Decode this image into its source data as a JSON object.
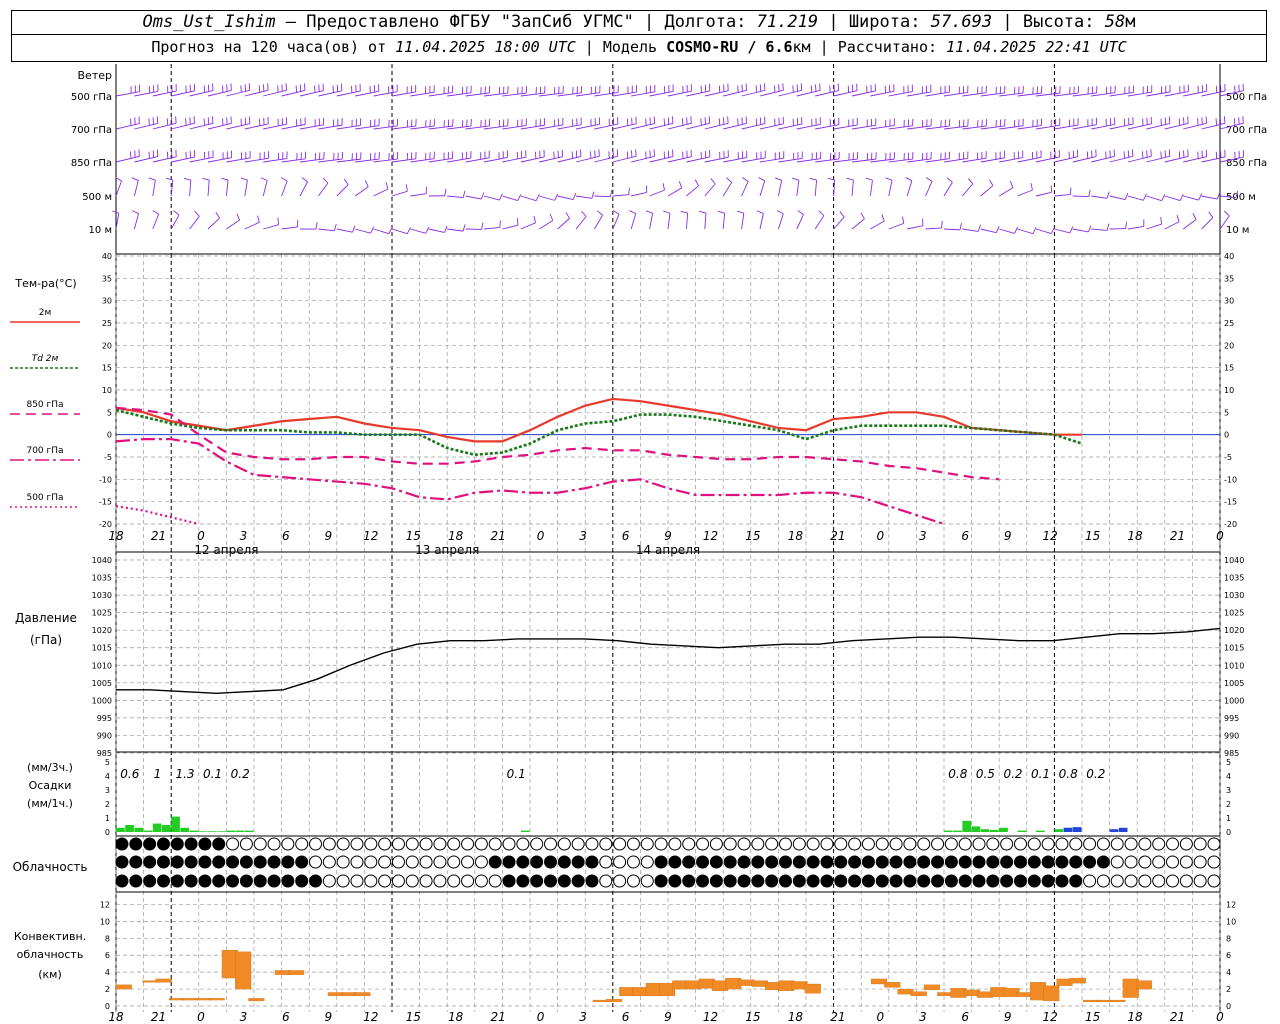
{
  "header": {
    "station": "Oms_Ust_Ishim",
    "dash": "–",
    "provider": "Предоставлено ФГБУ \"ЗапСиб УГМС\"",
    "lon_label": "Долгота:",
    "lon": "71.219",
    "lat_label": "Широта:",
    "lat": "57.693",
    "alt_label": "Высота:",
    "alt": "58",
    "alt_unit": "м",
    "forecast_label": "Прогноз на 120 часа(ов) от",
    "forecast_from": "11.04.2025 18:00 UTC",
    "model_label": "Модель",
    "model": "COSMO-RU / 6.6",
    "model_unit": "км",
    "calc_label": "Рассчитано:",
    "calc_time": "11.04.2025 22:41 UTC"
  },
  "colors": {
    "wind": "#8a2be2",
    "t2m": "#e8392b",
    "td2m": "#1a7a1a",
    "t850": "#e0107f",
    "precip_rain": "#22cc22",
    "precip_snow": "#2244dd",
    "convective": "#f08a24",
    "grid": "#9a9a9a",
    "zero_line": "#1f3fd0"
  },
  "chart_data": [
    {
      "type": "wind_barbs",
      "title": "Ветер",
      "levels": [
        "500 гПа",
        "700 гПа",
        "850 гПа",
        "500 м",
        "10 м"
      ]
    },
    {
      "type": "line",
      "title": "Тем-ра(°С)",
      "ylim": [
        -20,
        40
      ],
      "yticks": [
        -20,
        -15,
        -10,
        -5,
        0,
        5,
        10,
        15,
        20,
        25,
        30,
        35,
        40
      ],
      "time_hours_from_start": [
        0,
        3,
        6,
        9,
        12,
        15,
        18,
        21,
        24,
        27,
        30,
        33,
        36,
        39,
        42,
        45,
        48,
        51,
        54,
        57,
        60,
        63,
        66,
        69,
        72,
        75,
        78,
        81,
        84,
        87,
        90,
        93,
        96,
        99,
        102,
        105,
        108,
        111,
        114,
        117,
        120
      ],
      "series": [
        {
          "name": "2м",
          "values": [
            6,
            5,
            3,
            2,
            1,
            2,
            3,
            3.5,
            4,
            2.5,
            1.5,
            1,
            -0.5,
            -1.5,
            -1.5,
            1,
            4,
            6.5,
            8,
            7.5,
            6.5,
            5.5,
            4.5,
            3,
            1.5,
            1,
            3.5,
            4,
            5,
            5,
            4,
            1.5,
            1,
            0.5,
            0,
            0
          ]
        },
        {
          "name": "Td 2м",
          "values": [
            5.5,
            4,
            2.5,
            1.5,
            1,
            1,
            1,
            0.5,
            0.5,
            0,
            0,
            0,
            -3,
            -4.5,
            -4,
            -2,
            1,
            2.5,
            3,
            4.5,
            4.5,
            4,
            3,
            2,
            1,
            -1,
            1,
            2,
            2,
            2,
            2,
            1.5,
            1,
            0.5,
            0,
            -2
          ]
        },
        {
          "name": "850 гПа",
          "values": [
            6,
            5.5,
            4.5,
            0,
            -4,
            -5,
            -5.5,
            -5.5,
            -5,
            -5,
            -6,
            -6.5,
            -6.5,
            -6,
            -5,
            -4.5,
            -3.5,
            -3,
            -3.5,
            -3.5,
            -4.5,
            -5,
            -5.5,
            -5.5,
            -5,
            -5,
            -5.5,
            -6,
            -7,
            -7.5,
            -8.5,
            -9.5,
            -10
          ]
        },
        {
          "name": "700 гПа",
          "values": [
            -1.5,
            -1,
            -1,
            -2,
            -6,
            -9,
            -9.5,
            -10,
            -10.5,
            -11,
            -12,
            -14,
            -14.5,
            -13,
            -12.5,
            -13,
            -13,
            -12,
            -10.5,
            -10,
            -12,
            -13.5,
            -13.5,
            -13.5,
            -13.5,
            -13,
            -13,
            -14,
            -16,
            -18,
            -20
          ]
        },
        {
          "name": "500 гПа",
          "values": [
            -16,
            -17,
            -18.5,
            -20
          ]
        }
      ]
    },
    {
      "type": "line",
      "title": "Давление",
      "ylabel": "(гПа)",
      "ylim": [
        985,
        1040
      ],
      "yticks": [
        985,
        990,
        995,
        1000,
        1005,
        1010,
        1015,
        1020,
        1025,
        1030,
        1035,
        1040
      ],
      "values": [
        1003,
        1003,
        1002.5,
        1002,
        1002.5,
        1003,
        1006,
        1010,
        1013.5,
        1016,
        1017,
        1017,
        1017.5,
        1017.5,
        1017.5,
        1017,
        1016,
        1015.5,
        1015,
        1015.5,
        1016,
        1016,
        1017,
        1017.5,
        1018,
        1018,
        1017.5,
        1017,
        1017,
        1018,
        1019,
        1019,
        1019.5,
        1020.5
      ]
    },
    {
      "type": "bar",
      "title": "Осадки",
      "ylabel_top": "(мм/3ч.)",
      "ylabel_bottom": "(мм/1ч.)",
      "ylim": [
        0,
        5
      ],
      "yticks": [
        0,
        1,
        2,
        3,
        4,
        5
      ],
      "totals_3h": [
        {
          "x": 1.5,
          "label": "0.6"
        },
        {
          "x": 4.5,
          "label": "1"
        },
        {
          "x": 7.5,
          "label": "1.3"
        },
        {
          "x": 10.5,
          "label": "0.1"
        },
        {
          "x": 13.5,
          "label": "0.2"
        },
        {
          "x": 43.5,
          "label": "0.1"
        },
        {
          "x": 91.5,
          "label": "0.8"
        },
        {
          "x": 94.5,
          "label": "0.5"
        },
        {
          "x": 97.5,
          "label": "0.2"
        },
        {
          "x": 100.5,
          "label": "0.1"
        },
        {
          "x": 103.5,
          "label": "0.8"
        },
        {
          "x": 106.5,
          "label": "0.2"
        }
      ],
      "hourly_rain": [
        [
          0,
          0.3
        ],
        [
          1,
          0.5
        ],
        [
          2,
          0.3
        ],
        [
          3,
          0.1
        ],
        [
          4,
          0.6
        ],
        [
          5,
          0.5
        ],
        [
          6,
          1.1
        ],
        [
          7,
          0.3
        ],
        [
          8,
          0.1
        ],
        [
          9,
          0.05
        ],
        [
          10,
          0.05
        ],
        [
          11,
          0.05
        ],
        [
          12,
          0.1
        ],
        [
          13,
          0.1
        ],
        [
          14,
          0.1
        ],
        [
          44,
          0.1
        ],
        [
          90,
          0.1
        ],
        [
          91,
          0.1
        ],
        [
          92,
          0.8
        ],
        [
          93,
          0.4
        ],
        [
          94,
          0.2
        ],
        [
          95,
          0.15
        ],
        [
          96,
          0.3
        ],
        [
          98,
          0.1
        ],
        [
          100,
          0.1
        ],
        [
          102,
          0.2
        ],
        [
          103,
          0.3
        ],
        [
          104,
          0.1
        ]
      ],
      "hourly_snow": [
        [
          103,
          0.3
        ],
        [
          104,
          0.35
        ],
        [
          108,
          0.2
        ],
        [
          109,
          0.3
        ]
      ]
    },
    {
      "type": "cloud_cover",
      "title": "Облачность",
      "rows": 3
    },
    {
      "type": "bar",
      "title": "Конвективн. облачность (км)",
      "ylim": [
        0,
        13
      ],
      "yticks": [
        0,
        2,
        4,
        6,
        8,
        10,
        12
      ],
      "ranges_km": [
        [
          0,
          2,
          2.5
        ],
        [
          2,
          2.8,
          3
        ],
        [
          3,
          2.8,
          3.2
        ],
        [
          4,
          0.7,
          0.9
        ],
        [
          5,
          0.7,
          0.9
        ],
        [
          6,
          0.7,
          0.9
        ],
        [
          7,
          0.7,
          0.9
        ],
        [
          8,
          3.3,
          6.6
        ],
        [
          9,
          2,
          6.4
        ],
        [
          10,
          0.6,
          0.9
        ],
        [
          12,
          3.7,
          4.2
        ],
        [
          13,
          3.7,
          4.2
        ],
        [
          16,
          1.2,
          1.6
        ],
        [
          17,
          1.2,
          1.6
        ],
        [
          18,
          1.2,
          1.6
        ],
        [
          36,
          0.5,
          0.7
        ],
        [
          37,
          0.5,
          0.8
        ],
        [
          38,
          1.2,
          2.2
        ],
        [
          39,
          1.2,
          2.2
        ],
        [
          40,
          1.2,
          2.7
        ],
        [
          41,
          1.2,
          2.7
        ],
        [
          42,
          2,
          3
        ],
        [
          43,
          2,
          3
        ],
        [
          44,
          2.1,
          3.2
        ],
        [
          45,
          1.8,
          3
        ],
        [
          46,
          2,
          3.3
        ],
        [
          47,
          2.4,
          3.1
        ],
        [
          48,
          2.3,
          3
        ],
        [
          49,
          1.9,
          2.8
        ],
        [
          50,
          1.8,
          3
        ],
        [
          51,
          2,
          2.9
        ],
        [
          52,
          1.5,
          2.6
        ],
        [
          57,
          2.6,
          3.2
        ],
        [
          58,
          2.2,
          2.8
        ],
        [
          59,
          1.4,
          2
        ],
        [
          60,
          1.2,
          1.7
        ],
        [
          61,
          1.9,
          2.5
        ],
        [
          62,
          1.2,
          1.6
        ],
        [
          63,
          1,
          2.1
        ],
        [
          64,
          1.2,
          1.9
        ],
        [
          65,
          1,
          1.7
        ],
        [
          66,
          1.1,
          2.2
        ],
        [
          67,
          1.1,
          2.1
        ],
        [
          68,
          1.1,
          1.6
        ],
        [
          69,
          0.7,
          2.8
        ],
        [
          70,
          0.6,
          2.4
        ],
        [
          71,
          2.4,
          3.2
        ],
        [
          72,
          2.7,
          3.3
        ],
        [
          73,
          0.5,
          0.7
        ],
        [
          74,
          0.5,
          0.7
        ],
        [
          75,
          0.5,
          0.7
        ],
        [
          76,
          1,
          3.2
        ],
        [
          77,
          2,
          3
        ]
      ]
    }
  ],
  "axis": {
    "tick_labels": [
      "18",
      "21",
      "0",
      "3",
      "6",
      "9",
      "12",
      "15",
      "18",
      "21",
      "0",
      "3",
      "6",
      "9",
      "12",
      "15",
      "18",
      "21",
      "0",
      "3",
      "6",
      "9",
      "12",
      "15",
      "18",
      "21",
      "0"
    ],
    "date_labels": [
      {
        "at": "12",
        "label": "12 апреля"
      },
      {
        "at": "36",
        "label": "13 апреля"
      },
      {
        "at": "60",
        "label": "14 апреля"
      }
    ]
  }
}
